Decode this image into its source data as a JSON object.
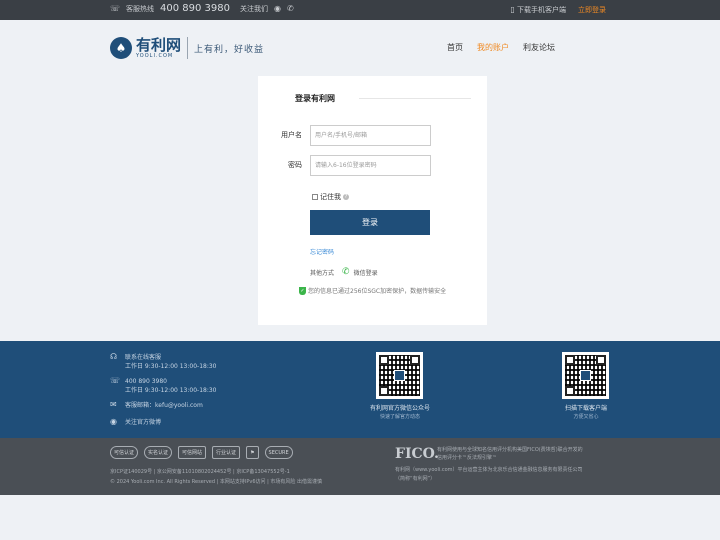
{
  "topbar": {
    "hotline_label": "客服热线",
    "hotline_number": "400 890 3980",
    "follow_label": "关注我们",
    "app_download": "下载手机客户端",
    "login_now": "立即登录"
  },
  "header": {
    "logo_cn": "有利网",
    "logo_en": "YOOLI.COM",
    "slogan": "上有利，好收益",
    "nav": [
      "首页",
      "我的账户",
      "利友论坛"
    ]
  },
  "login": {
    "title": "登录有利网",
    "username_label": "用户名",
    "username_placeholder": "用户名/手机号/邮箱",
    "password_label": "密码",
    "password_placeholder": "请输入6-16位登录密码",
    "remember_label": "记住我",
    "submit_label": "登录",
    "forgot_label": "忘记密码",
    "other_label": "其他方式",
    "wechat_label": "微信登录",
    "secure_note": "您的信息已通过256位SGC加密保护，数据传输安全"
  },
  "footer_contact": {
    "online_service": "联系在线客服",
    "online_hours": "工作日 9:30-12:00 13:00-18:30",
    "phone": "400 890 3980",
    "phone_hours": "工作日 9:30-12:00 13:00-18:30",
    "email": "客服邮箱：kefu@yooli.com",
    "weibo": "关注官方微博"
  },
  "footer_qr": [
    {
      "title": "有利网官方微信公众号",
      "subtitle": "快速了解官方动态"
    },
    {
      "title": "扫描下载客户端",
      "subtitle": "方便又省心"
    }
  ],
  "footer_badges": [
    "可信认证",
    "实名认证",
    "可信网站",
    "行业认证",
    "",
    "SECURE"
  ],
  "footer_legal": {
    "line1": "京ICP证140029号 | 京公网安备11010802024452号 | 京ICP备13047552号-1",
    "line2": "© 2024 Yooli.com Inc. All Rights Reserved | 本网站支持IPv6访问 | 市场有风险 出借需谨慎",
    "fico": "FICO.",
    "fico_text": "有利网使用与全球知名信用评分机构美国FICO(费埃哲)联合开发的信用评分卡™反法规引擎™",
    "site_text": "有利网（www.yooli.com）平台运营主体为北京乐合信通金融信息服务有限责任公司（简称“有利网”）"
  }
}
